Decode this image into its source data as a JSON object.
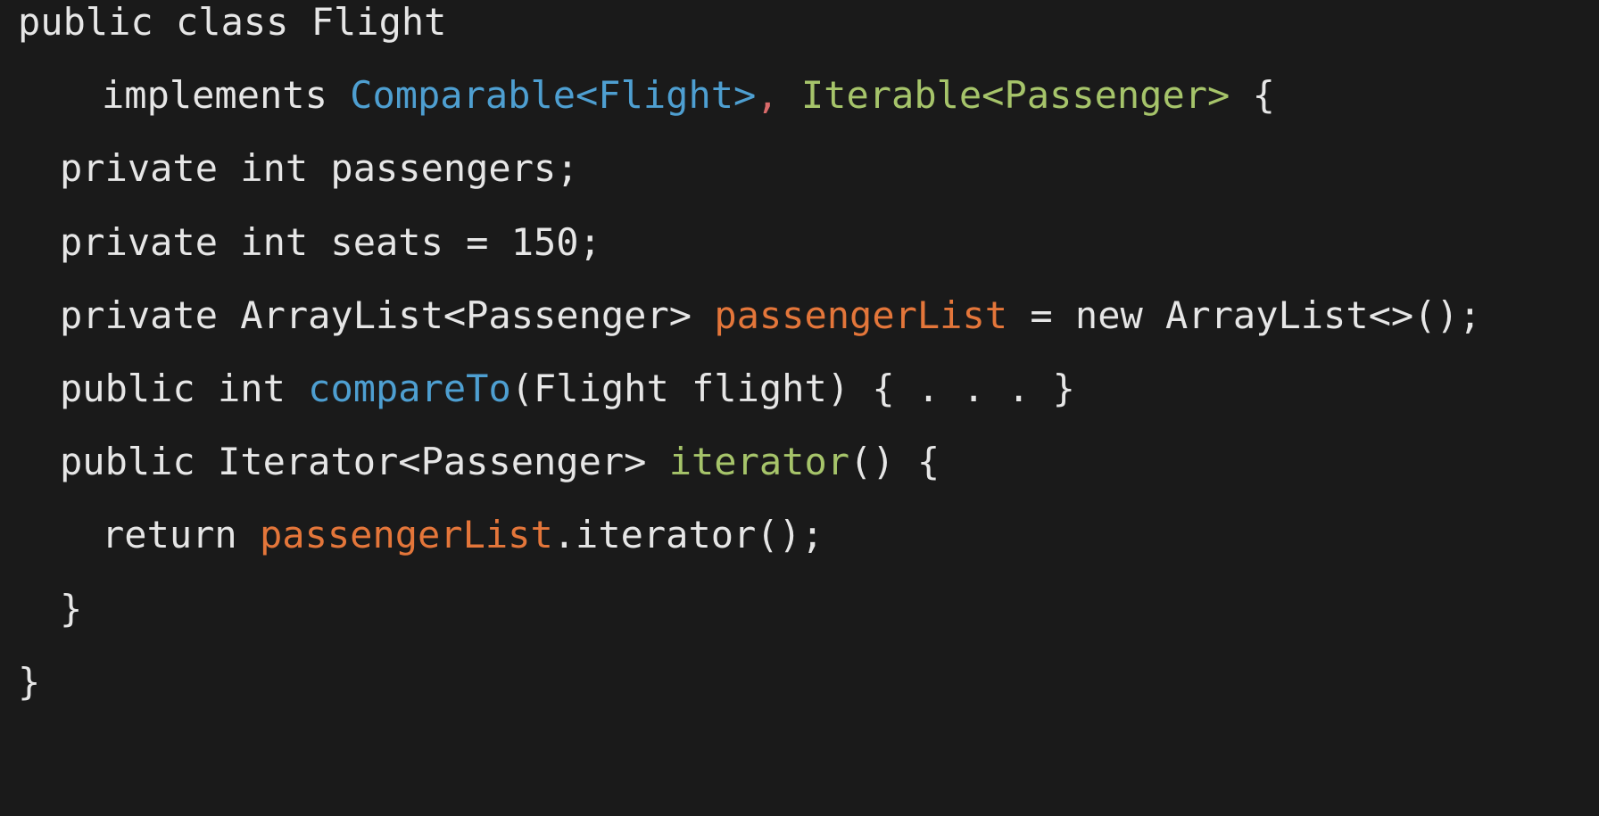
{
  "editor": {
    "background": "#1a1a1a",
    "default_color": "#e6e6e6",
    "colors": {
      "type_ref": "#4e9fd1",
      "type_ref_alt": "#a6c46a",
      "punctuation_accent": "#d96a6a",
      "field": "#e4763a",
      "method_blue": "#4e9fd1",
      "method_green": "#a6c46a"
    },
    "lines": [
      {
        "indent": 0,
        "tokens": [
          {
            "t": "public class Flight",
            "c": "default"
          }
        ]
      },
      {
        "indent": 2,
        "tokens": [
          {
            "t": "implements ",
            "c": "default"
          },
          {
            "t": "Comparable<Flight>",
            "c": "type_ref"
          },
          {
            "t": ", ",
            "c": "punctuation_accent"
          },
          {
            "t": "Iterable<Passenger>",
            "c": "type_ref_alt"
          },
          {
            "t": " {",
            "c": "default"
          }
        ]
      },
      {
        "indent": 1,
        "tokens": [
          {
            "t": "private int passengers;",
            "c": "default"
          }
        ]
      },
      {
        "indent": 1,
        "tokens": [
          {
            "t": "private int seats = 150;",
            "c": "default"
          }
        ]
      },
      {
        "indent": 1,
        "tokens": [
          {
            "t": "private ArrayList<Passenger> ",
            "c": "default"
          },
          {
            "t": "passengerList",
            "c": "field"
          },
          {
            "t": " = new ArrayList<>();",
            "c": "default"
          }
        ]
      },
      {
        "indent": 1,
        "tokens": [
          {
            "t": "public int ",
            "c": "default"
          },
          {
            "t": "compareTo",
            "c": "method_blue"
          },
          {
            "t": "(Flight flight) { . . . }",
            "c": "default"
          }
        ]
      },
      {
        "indent": 1,
        "tokens": [
          {
            "t": "public Iterator<Passenger> ",
            "c": "default"
          },
          {
            "t": "iterator",
            "c": "method_green"
          },
          {
            "t": "() {",
            "c": "default"
          }
        ]
      },
      {
        "indent": 2,
        "tokens": [
          {
            "t": "return ",
            "c": "default"
          },
          {
            "t": "passengerList",
            "c": "field"
          },
          {
            "t": ".iterator();",
            "c": "default"
          }
        ]
      },
      {
        "indent": 1,
        "tokens": [
          {
            "t": "}",
            "c": "default"
          }
        ]
      },
      {
        "indent": 0,
        "tokens": [
          {
            "t": "}",
            "c": "default"
          }
        ]
      }
    ]
  }
}
